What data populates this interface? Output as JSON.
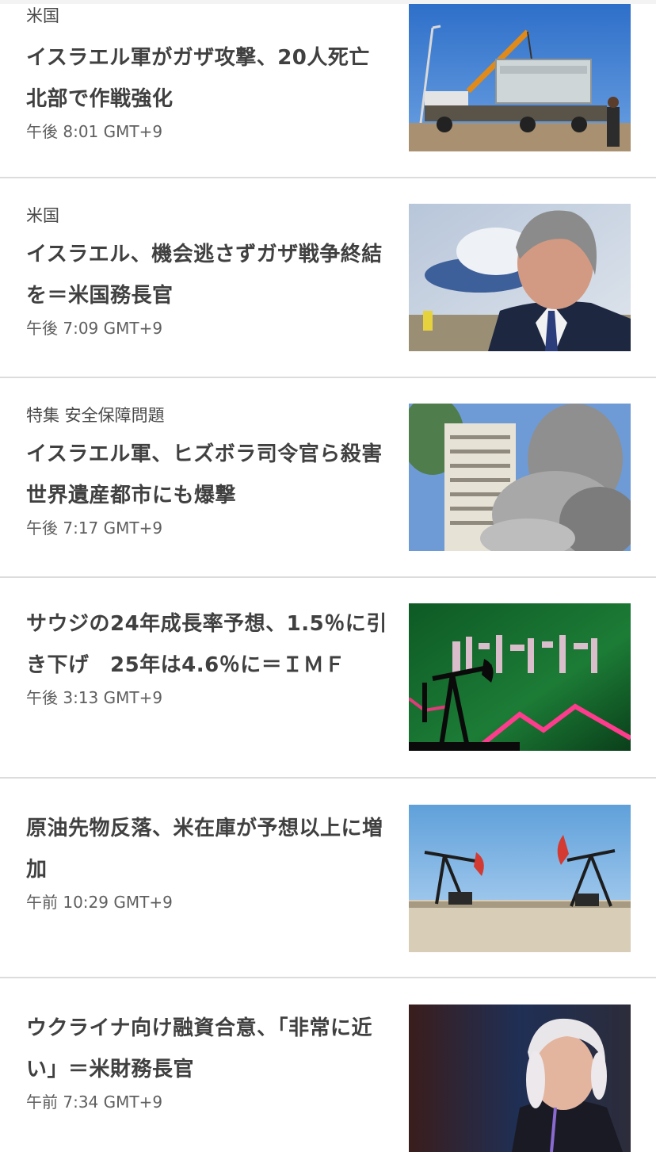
{
  "feed": {
    "articles": [
      {
        "kicker": "米国",
        "headline": "イスラエル軍がガザ攻撃、20人死亡　北部で作戦強化",
        "timestamp": "午後 8:01 GMT+9",
        "image_subject": "crane-truck-photo"
      },
      {
        "kicker": "米国",
        "headline": "イスラエル、機会逃さずガザ戦争終結を＝米国務長官",
        "timestamp": "午後 7:09 GMT+9",
        "image_subject": "official-portrait-photo"
      },
      {
        "kicker": "特集 安全保障問題",
        "headline": "イスラエル軍、ヒズボラ司令官ら殺害　世界遺産都市にも爆撃",
        "timestamp": "午後 7:17 GMT+9",
        "image_subject": "building-smoke-photo"
      },
      {
        "kicker": "",
        "headline": "サウジの24年成長率予想、1.5％に引き下げ　25年は4.6％に＝ＩＭＦ",
        "timestamp": "午後 3:13 GMT+9",
        "image_subject": "oil-pump-flag-photo"
      },
      {
        "kicker": "",
        "headline": "原油先物反落、米在庫が予想以上に増加",
        "timestamp": "午前 10:29 GMT+9",
        "image_subject": "oil-pumpjacks-photo"
      },
      {
        "kicker": "",
        "headline": "ウクライナ向け融資合意、「非常に近い」＝米財務長官",
        "timestamp": "午前 7:34 GMT+9",
        "image_subject": "official-speaking-photo"
      }
    ]
  }
}
